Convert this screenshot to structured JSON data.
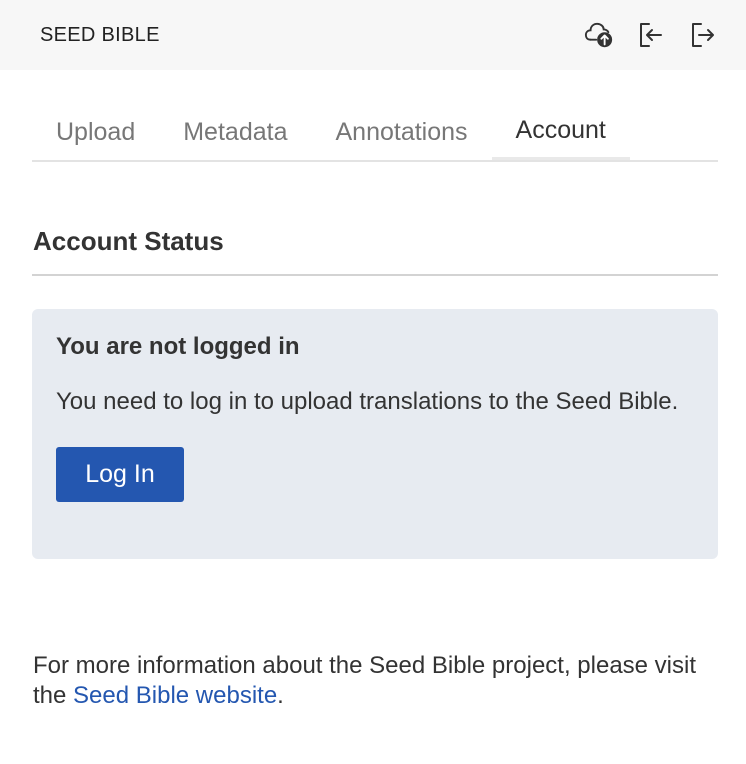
{
  "app": {
    "title": "SEED BIBLE"
  },
  "titlebar": {
    "icons": [
      "cloud-upload-icon",
      "login-icon",
      "logout-icon"
    ]
  },
  "tabs": [
    {
      "label": "Upload",
      "active": false
    },
    {
      "label": "Metadata",
      "active": false
    },
    {
      "label": "Annotations",
      "active": false
    },
    {
      "label": "Account",
      "active": true
    }
  ],
  "account": {
    "section_title": "Account Status",
    "status_heading": "You are not logged in",
    "status_text": "You need to log in to upload translations to the Seed Bible.",
    "login_label": "Log In"
  },
  "footer": {
    "text_before": "For more information about the Seed Bible project, please visit the ",
    "link_text": "Seed Bible website",
    "text_after": "."
  },
  "colors": {
    "accent": "#2457b0",
    "status_bg": "#e7ebf1",
    "titlebar_bg": "#f7f7f7"
  }
}
